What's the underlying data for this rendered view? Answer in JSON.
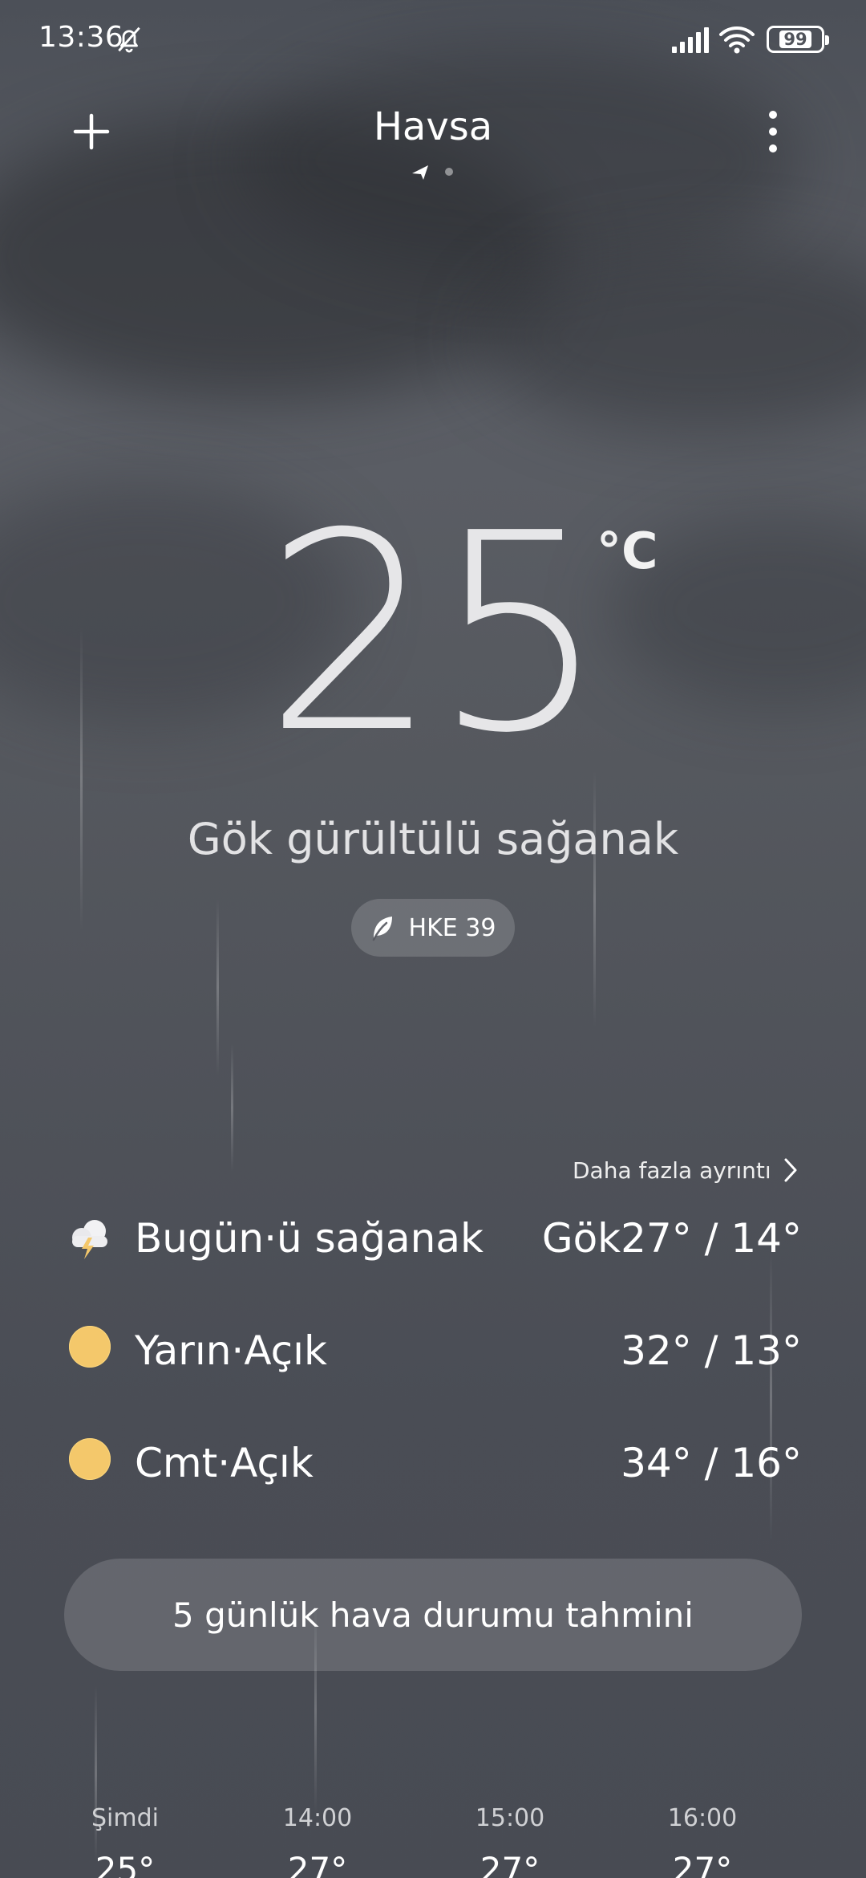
{
  "status_bar": {
    "time": "13:36",
    "battery": "99"
  },
  "header": {
    "city": "Havsa"
  },
  "current": {
    "temperature": "25",
    "unit": "°C",
    "condition": "Gök gürültülü sağanak",
    "aqi": "HKE 39"
  },
  "forecast": {
    "more_details": "Daha fazla ayrıntı",
    "days": [
      {
        "label": "Bugün·ü sağanak",
        "range": "Gök27° / 14°",
        "icon": "thunderstorm-icon"
      },
      {
        "label": "Yarın·Açık",
        "range": "32° / 13°",
        "icon": "sun-icon"
      },
      {
        "label": "Cmt·Açık",
        "range": "34° / 16°",
        "icon": "sun-icon"
      }
    ],
    "five_day_button": "5 günlük hava durumu tahmini"
  },
  "hourly": [
    {
      "time": "Şimdi",
      "temp": "25°"
    },
    {
      "time": "14:00",
      "temp": "27°"
    },
    {
      "time": "15:00",
      "temp": "27°"
    },
    {
      "time": "16:00",
      "temp": "27°"
    }
  ],
  "colors": {
    "sun": "#f4c86b",
    "background": "#55585f"
  }
}
